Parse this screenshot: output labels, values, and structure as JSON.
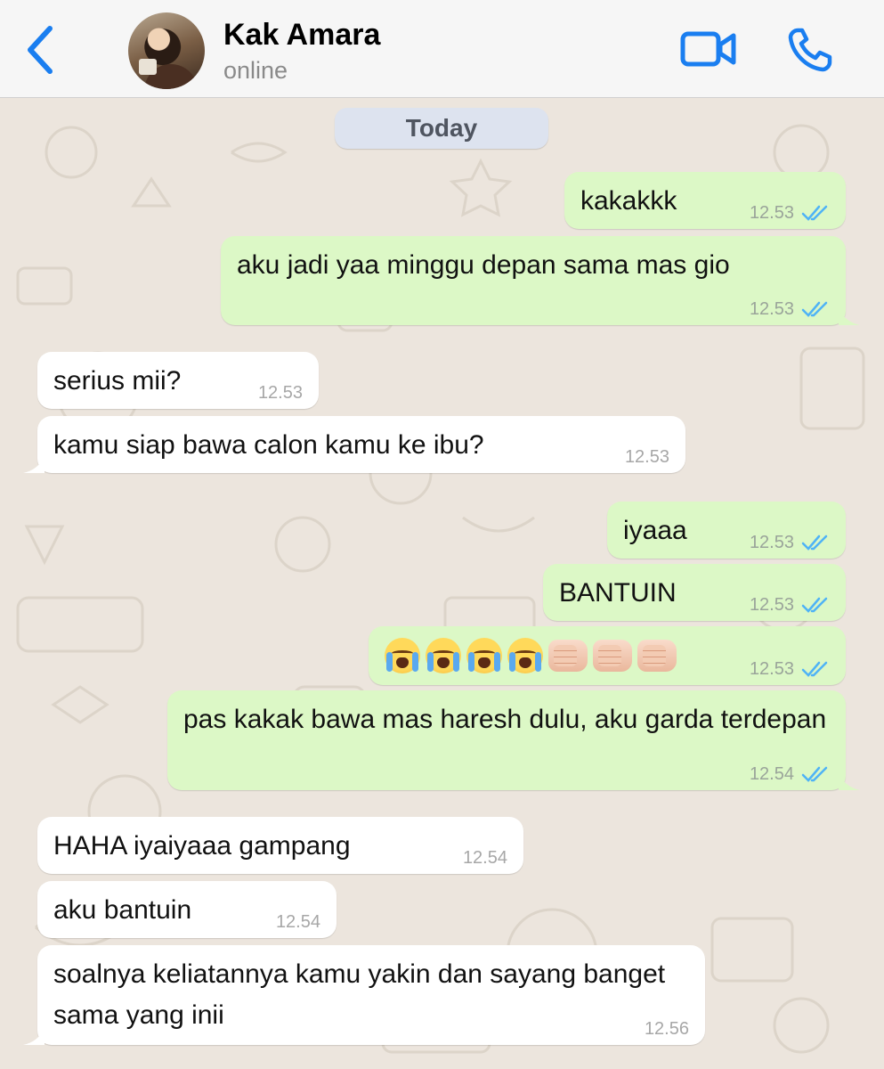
{
  "header": {
    "contact_name": "Kak Amara",
    "status": "online",
    "back_icon": "chevron-left-icon",
    "video_icon": "video-camera-icon",
    "call_icon": "phone-icon",
    "accent_color": "#1a7ef0"
  },
  "chat": {
    "date_label": "Today",
    "messages": [
      {
        "direction": "out",
        "text": "kakakkk",
        "time": "12.53",
        "status": "read"
      },
      {
        "direction": "out",
        "text": "aku jadi yaa minggu depan sama mas gio",
        "time": "12.53",
        "status": "read"
      },
      {
        "direction": "in",
        "text": "serius mii?",
        "time": "12.53"
      },
      {
        "direction": "in",
        "text": "kamu siap bawa calon kamu ke ibu?",
        "time": "12.53"
      },
      {
        "direction": "out",
        "text": "iyaaa",
        "time": "12.53",
        "status": "read"
      },
      {
        "direction": "out",
        "text": "BANTUIN",
        "time": "12.53",
        "status": "read"
      },
      {
        "direction": "out",
        "text": "😭😭😭😭👊🏻👊🏻👊🏻",
        "time": "12.53",
        "status": "read"
      },
      {
        "direction": "out",
        "text": "pas kakak bawa mas haresh dulu, aku garda terdepan",
        "time": "12.54",
        "status": "read"
      },
      {
        "direction": "in",
        "text": "HAHA iyaiyaaa gampang",
        "time": "12.54"
      },
      {
        "direction": "in",
        "text": "aku bantuin",
        "time": "12.54"
      },
      {
        "direction": "in",
        "text": "soalnya keliatannya kamu yakin dan sayang banget sama yang inii",
        "time": "12.56"
      }
    ]
  },
  "colors": {
    "outgoing_bubble": "#dcf8c6",
    "incoming_bubble": "#ffffff",
    "read_ticks": "#4fb3f6",
    "wallpaper": "#ece5dd"
  }
}
